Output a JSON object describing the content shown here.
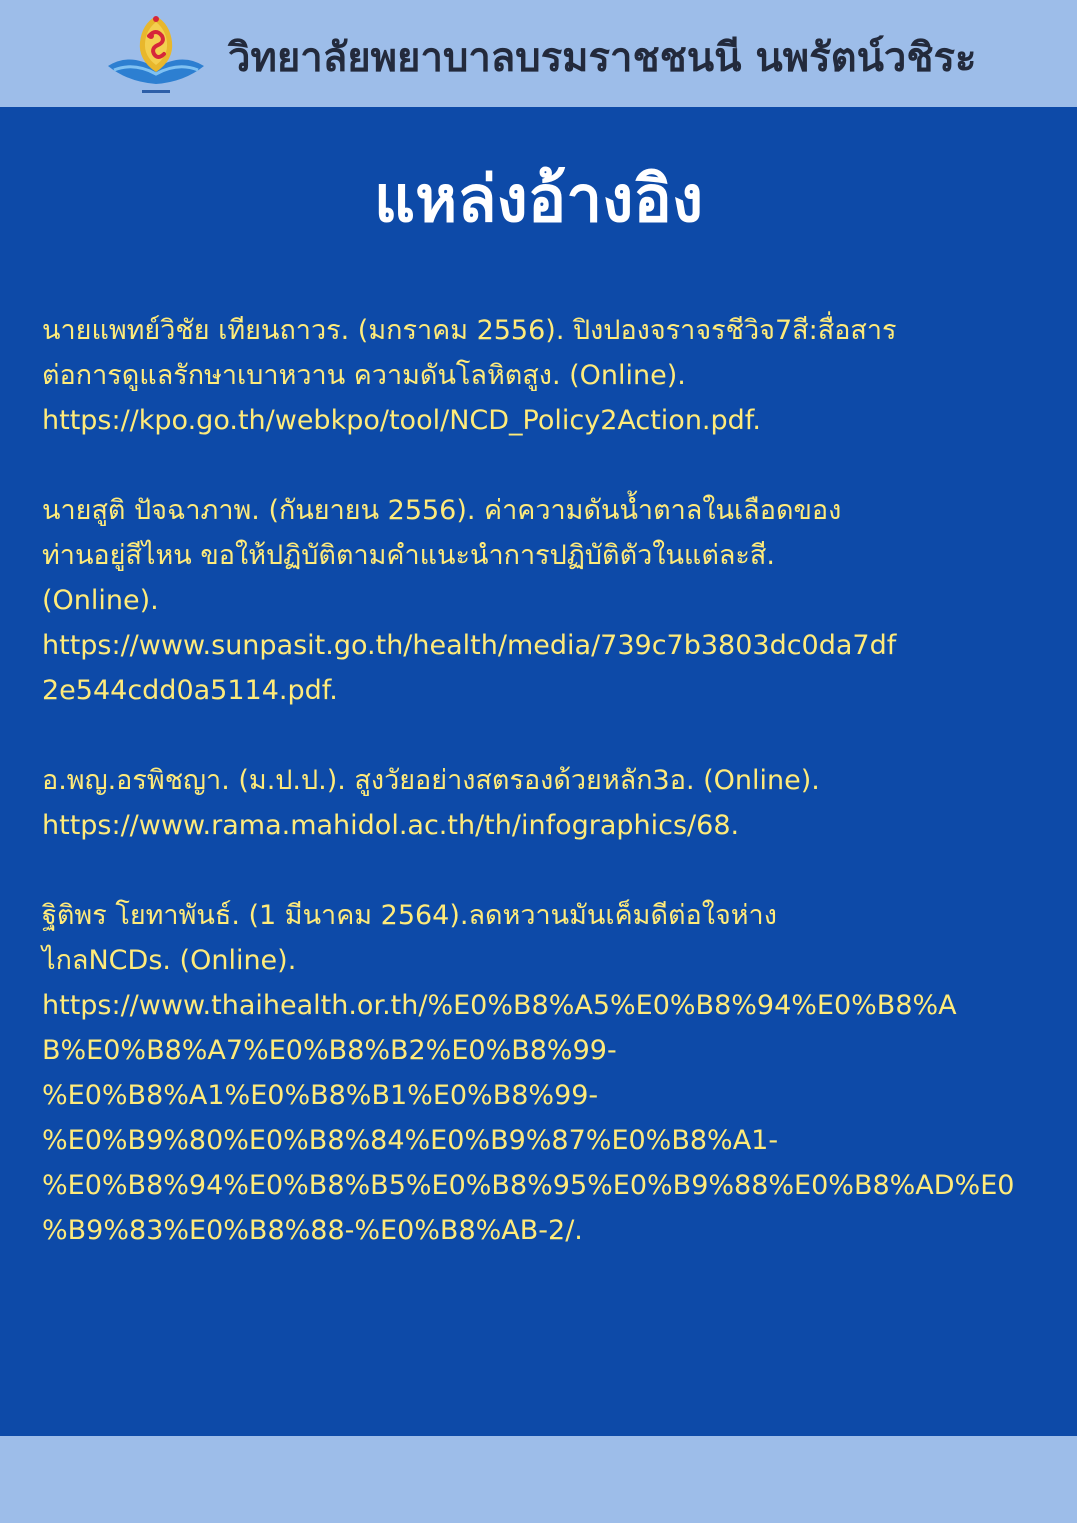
{
  "header": {
    "title": "วิทยาลัยพยาบาลบรมราชชนนี นพรัตน์วชิระ",
    "logo_icon": "college-emblem-icon"
  },
  "page_title": "แหล่งอ้างอิง",
  "colors": {
    "header_bg": "#9dbde9",
    "main_bg": "#0d4aa8",
    "reference_text": "#ffeb7a",
    "title_text": "#ffffff"
  },
  "references": [
    {
      "lines": [
        "นายแพทย์วิชัย เทียนถาวร. (มกราคม 2556). ปิงปองจราจรชีวิจ7สี:สื่อสาร",
        "ต่อการดูแลรักษาเบาหวาน ความดันโลหิตสูง. (Online).",
        "https://kpo.go.th/webkpo/tool/NCD_Policy2Action.pdf."
      ]
    },
    {
      "lines": [
        "นายสูติ ปัจฉาภาพ. (กันยายน 2556). ค่าความดันน้ำตาลในเลือดของ",
        "ท่านอยู่สีไหน ขอให้ปฏิบัติตามคำแนะนำการปฏิบัติตัวในแต่ละสี.",
        "(Online).",
        "https://www.sunpasit.go.th/health/media/739c7b3803dc0da7df",
        "2e544cdd0a5114.pdf."
      ]
    },
    {
      "lines": [
        "อ.พญ.อรพิชญา. (ม.ป.ป.). สูงวัยอย่างสตรองด้วยหลัก3อ. (Online).",
        "https://www.rama.mahidol.ac.th/th/infographics/68."
      ]
    },
    {
      "lines": [
        "ฐิติพร โยทาพันธ์. (1 มีนาคม 2564).ลดหวานมันเค็มดีต่อใจห่าง",
        "ไกลNCDs. (Online).",
        "https://www.thaihealth.or.th/%E0%B8%A5%E0%B8%94%E0%B8%A",
        "B%E0%B8%A7%E0%B8%B2%E0%B8%99-",
        "%E0%B8%A1%E0%B8%B1%E0%B8%99-",
        "%E0%B9%80%E0%B8%84%E0%B9%87%E0%B8%A1-",
        "%E0%B8%94%E0%B8%B5%E0%B8%95%E0%B9%88%E0%B8%AD%E0",
        "%B9%83%E0%B8%88-%E0%B8%AB-2/."
      ]
    }
  ]
}
